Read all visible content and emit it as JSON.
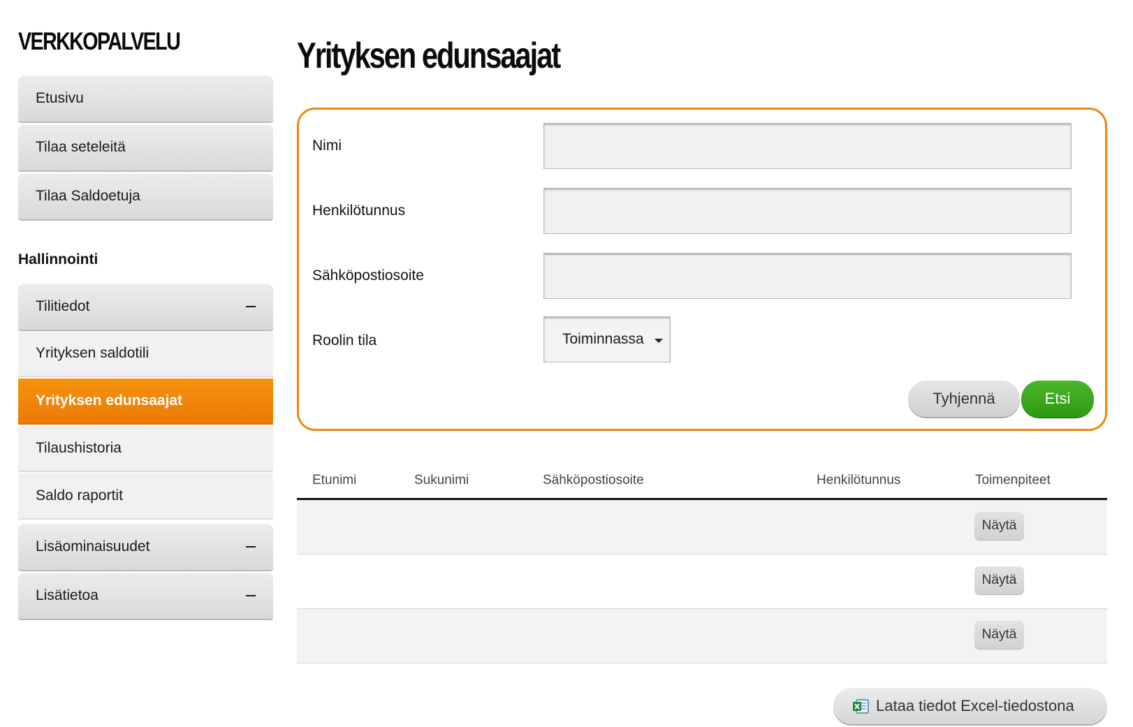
{
  "brand": "VERKKOPALVELU",
  "nav": {
    "top_items": [
      {
        "label": "Etusivu"
      },
      {
        "label": "Tilaa seteleitä"
      },
      {
        "label": "Tilaa Saldoetuja"
      }
    ],
    "section_heading": "Hallinnointi",
    "account_group": {
      "label": "Tilitiedot",
      "sub_items": [
        {
          "label": "Yrityksen saldotili"
        },
        {
          "label": "Yrityksen edunsaajat"
        },
        {
          "label": "Tilaushistoria"
        },
        {
          "label": "Saldo raportit"
        }
      ]
    },
    "extras_label": "Lisäominaisuudet",
    "info_label": "Lisätietoa"
  },
  "page_title": "Yrityksen edunsaajat",
  "form": {
    "name_label": "Nimi",
    "ssn_label": "Henkilötunnus",
    "email_label": "Sähköpostiosoite",
    "role_label": "Roolin tila",
    "role_value": "Toiminnassa",
    "clear_label": "Tyhjennä",
    "search_label": "Etsi"
  },
  "table": {
    "headers": [
      "Etunimi",
      "Sukunimi",
      "Sähköpostiosoite",
      "Henkilötunnus",
      "Toimenpiteet"
    ],
    "rows": [
      {
        "action": "Näytä"
      },
      {
        "action": "Näytä"
      },
      {
        "action": "Näytä"
      }
    ]
  },
  "excel_label": "Lataa tiedot Excel-tiedostona",
  "colors": {
    "accent_orange": "#ef8712",
    "search_green": "#3aa61c"
  }
}
